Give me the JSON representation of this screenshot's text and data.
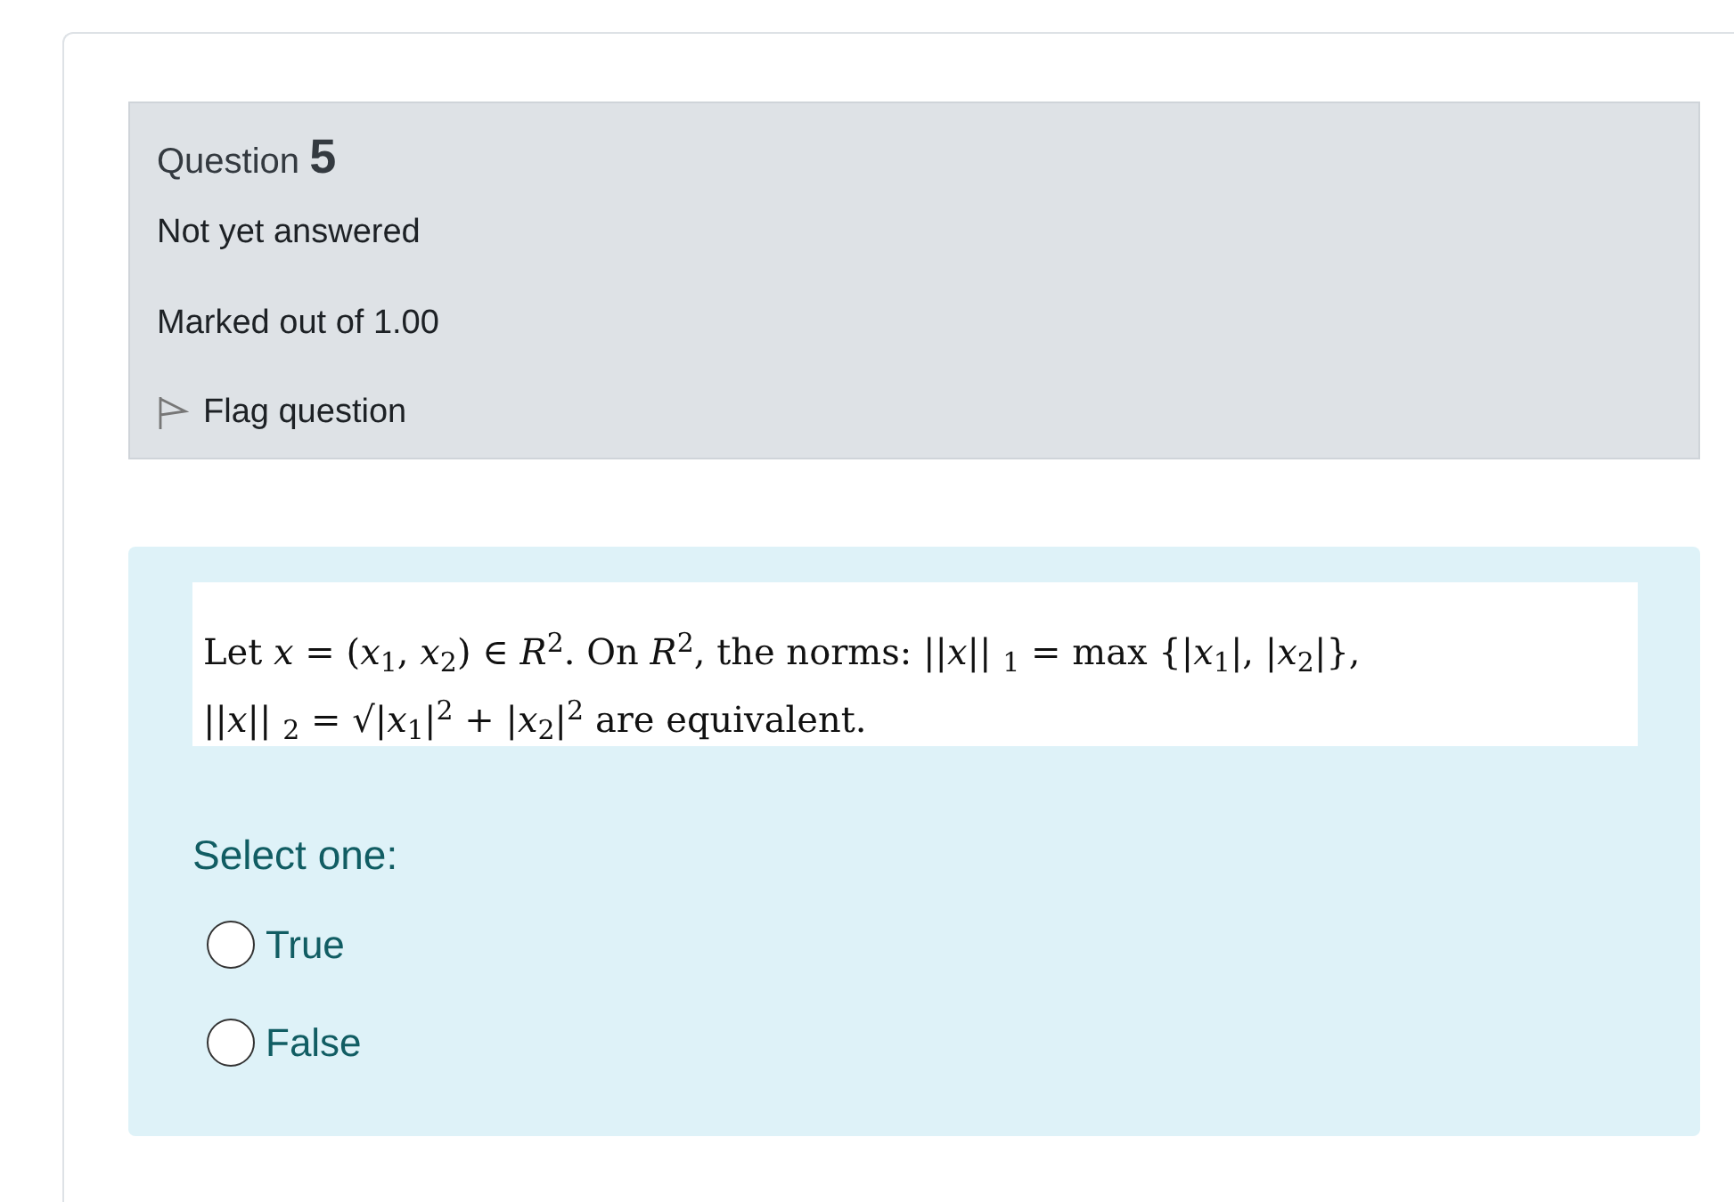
{
  "info": {
    "label": "Question",
    "number": "5",
    "status": "Not yet answered",
    "mark": "Marked out of 1.00",
    "flag": {
      "label": "Flag question",
      "flagged": false
    }
  },
  "question": {
    "lines": [
      "Let *x* = (*x*$_{1}$, *x*$_{2}$) ∈ *R*$^{2}$.  On *R*$^{2}$, the norms: ||*x*|| $_{1}$ = max {|*x*$_{1}$|, |*x*$_{2}$|},",
      "||*x*|| $_{2}$ = √|*x*$_{1}$|$^{2}$ + |*x*$_{2}$|$^{2}$ are equivalent."
    ],
    "prompt": "Select one:",
    "options": [
      {
        "label": "True",
        "selected": false
      },
      {
        "label": "False",
        "selected": false
      }
    ]
  }
}
